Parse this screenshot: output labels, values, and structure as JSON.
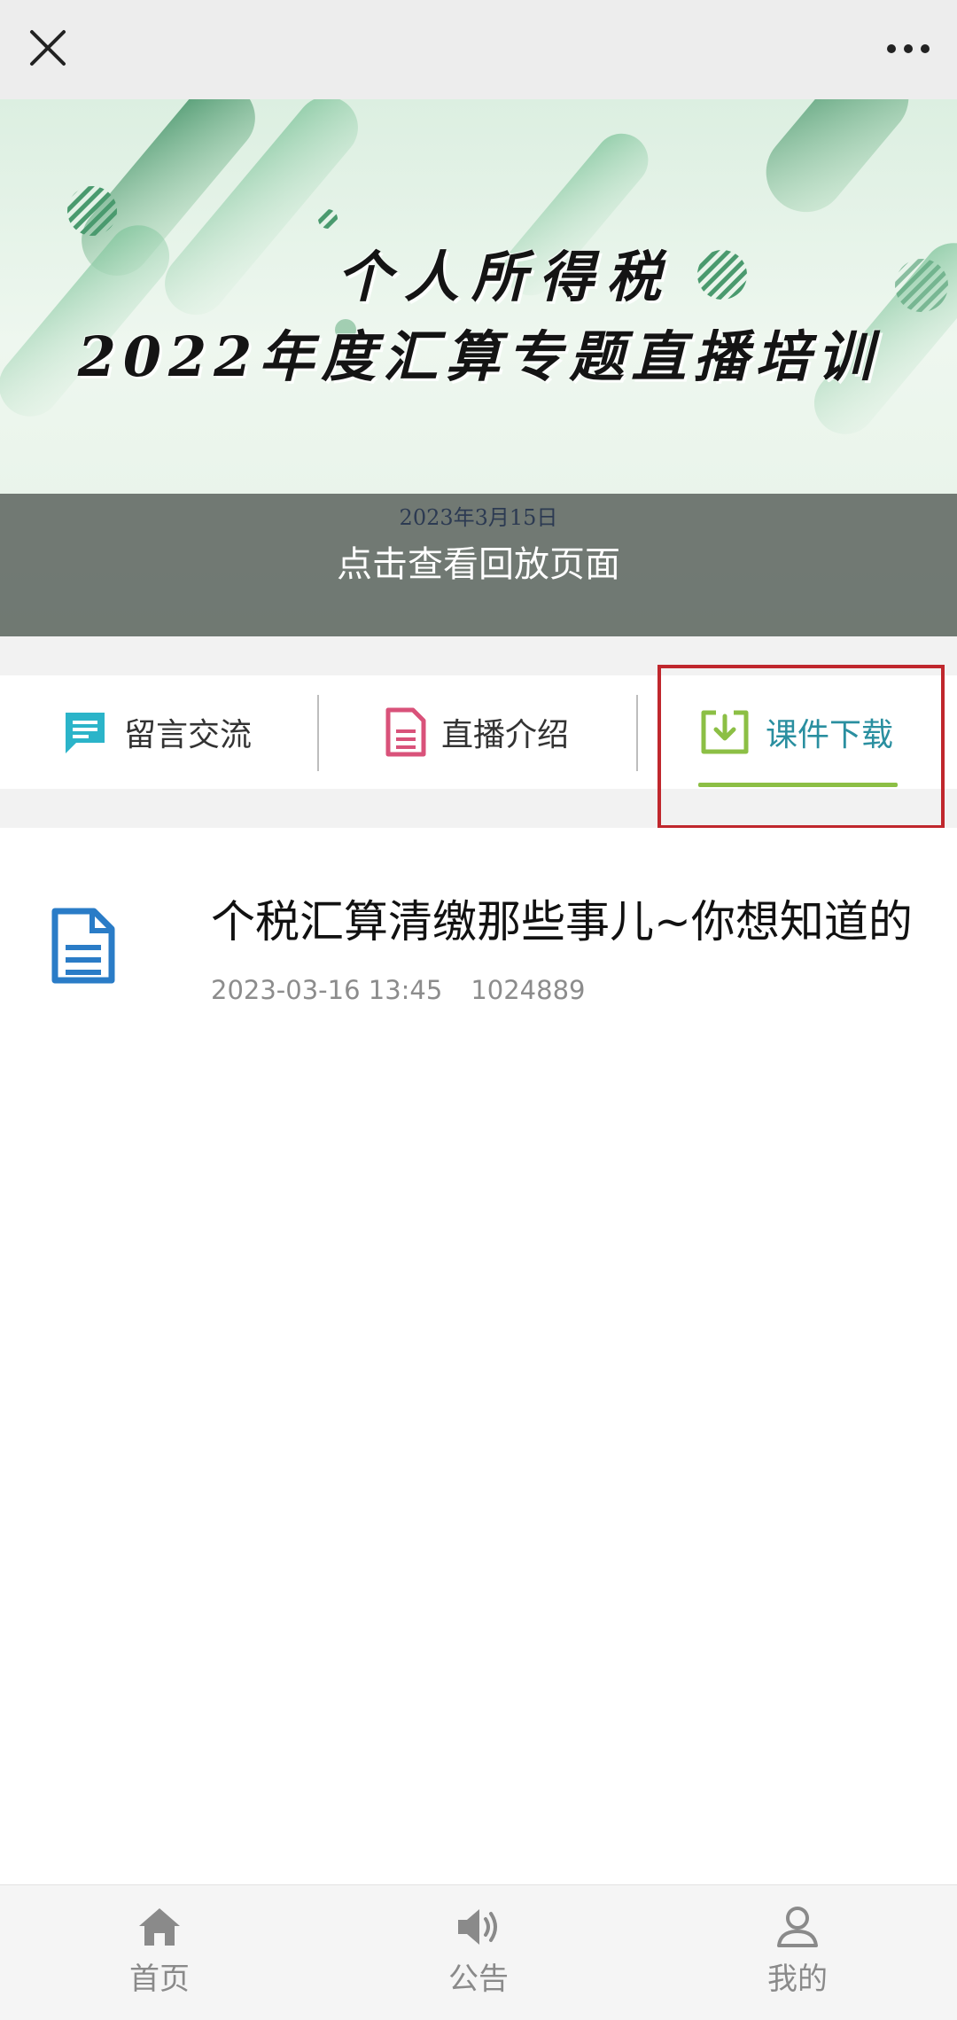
{
  "topbar": {
    "close_icon": "close-icon",
    "more_icon": "more-dots-icon"
  },
  "banner": {
    "title_line1": "个人所得税",
    "title_line2": "2022年度汇算专题直播培训",
    "date": "2023年3月15日",
    "replay_label": "点击查看回放页面"
  },
  "tabs": [
    {
      "label": "留言交流",
      "icon": "message-icon",
      "icon_color": "#2bb4c9",
      "active": false
    },
    {
      "label": "直播介绍",
      "icon": "document-icon",
      "icon_color": "#d9527a",
      "active": false
    },
    {
      "label": "课件下载",
      "icon": "download-icon",
      "icon_color": "#8cbf45",
      "active": true
    }
  ],
  "list": [
    {
      "title": "个税汇算清缴那些事儿~你想知道的",
      "date": "2023-03-16 13:45",
      "count": "1024889",
      "icon": "document-icon",
      "icon_color": "#2a7cc7"
    }
  ],
  "bottom_nav": [
    {
      "label": "首页",
      "icon": "home-icon"
    },
    {
      "label": "公告",
      "icon": "speaker-icon"
    },
    {
      "label": "我的",
      "icon": "user-icon"
    }
  ],
  "colors": {
    "accent": "#8cbf45",
    "active_tab_text": "#2a8fa0",
    "highlight_border": "#c0272d"
  }
}
